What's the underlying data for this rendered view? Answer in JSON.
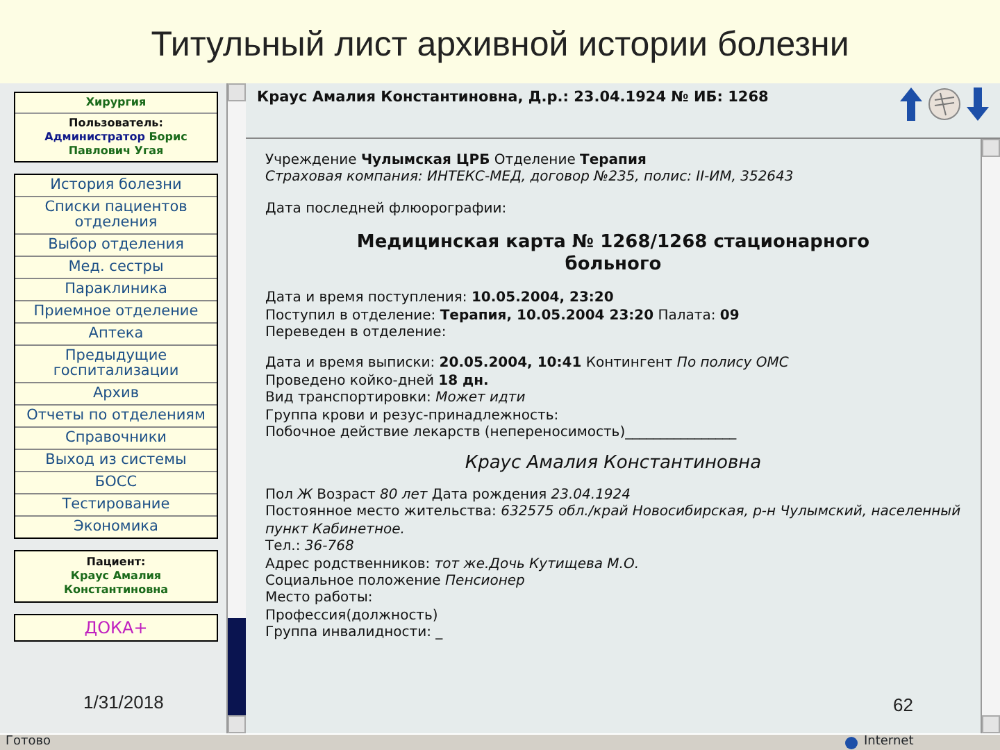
{
  "slide_title": "Титульный лист архивной истории болезни",
  "sidebar": {
    "department": "Хирургия",
    "user_label": "Пользователь:",
    "user_role": "Администратор",
    "user_name": "Борис Павлович Угая"
  },
  "menu": [
    "История болезни",
    "Списки пациентов отделения",
    "Выбор отделения",
    "Мед. сестры",
    "Параклиника",
    "Приемное отделение",
    "Аптека",
    "Предыдущие госпитализации",
    "Архив",
    "Отчеты по отделениям",
    "Справочники",
    "Выход из системы",
    "БОСС",
    "Тестирование",
    "Экономика"
  ],
  "patient_box": {
    "label": "Пациент:",
    "name": "Краус Амалия Константиновна"
  },
  "sidebar_logo": "ДОКА+",
  "header": {
    "text": "Краус Амалия Константиновна, Д.р.: 23.04.1924",
    "record_no": "№ ИБ: 1268"
  },
  "document": [
    {
      "kind": "lines",
      "lines": [
        {
          "kind": "plain",
          "text": "Учреждение **Чулымская ЦРБ**    Отделение **Терапия**"
        },
        {
          "kind": "italic",
          "text": "Страховая компания: ИНТЕКС-МЕД, договор №235, полис: II-ИМ, 352643"
        }
      ]
    },
    {
      "kind": "lines",
      "lines": [
        {
          "kind": "plain",
          "text": "Дата последней флюорографии:"
        }
      ]
    },
    {
      "kind": "heading",
      "text": "Медицинская карта № 1268/1268 стационарного больного"
    },
    {
      "kind": "lines",
      "lines": [
        {
          "kind": "plain",
          "text": "Дата и время поступления: **10.05.2004, 23:20**"
        },
        {
          "kind": "plain",
          "text": "Поступил в отделение: **Терапия, 10.05.2004 23:20** Палата: **09**"
        },
        {
          "kind": "plain",
          "text": "Переведен в отделение:"
        }
      ]
    },
    {
      "kind": "lines",
      "lines": [
        {
          "kind": "plain",
          "text": "Дата и время выписки: **20.05.2004, 10:41** Контингент *По полису ОМС*"
        },
        {
          "kind": "plain",
          "text": "Проведено койко-дней **18 дн.**"
        },
        {
          "kind": "plain",
          "text": "Вид транспортировки: *Может идти*"
        },
        {
          "kind": "plain",
          "text": "Группа крови и резус-принадлежность:"
        },
        {
          "kind": "plain",
          "text": "Побочное действие лекарств (непереносимость)________________"
        }
      ]
    },
    {
      "kind": "name",
      "text": "Краус Амалия Константиновна"
    },
    {
      "kind": "lines",
      "lines": [
        {
          "kind": "plain",
          "text": "Пол *Ж* Возраст *80 лет* Дата рождения *23.04.1924*"
        },
        {
          "kind": "plain",
          "text": "Постоянное место жительства: *632575 обл./край Новосибирская, р-н Чулымский, населенный пункт Кабинетное.*"
        },
        {
          "kind": "plain",
          "text": "Тел.: *36-768*"
        },
        {
          "kind": "plain",
          "text": "Адрес родственников: *тот же.Дочь Кутищева М.О.*"
        },
        {
          "kind": "plain",
          "text": "Социальное положение *Пенсионер*"
        },
        {
          "kind": "plain",
          "text": "Место работы:"
        },
        {
          "kind": "plain",
          "text": "Профессия(должность)"
        },
        {
          "kind": "plain",
          "text": "Группа инвалидности: _"
        }
      ]
    }
  ],
  "status_bar": {
    "text": "Готово",
    "zone": "Internet"
  },
  "slide_footer": {
    "date": "1/31/2018",
    "page": "62"
  }
}
